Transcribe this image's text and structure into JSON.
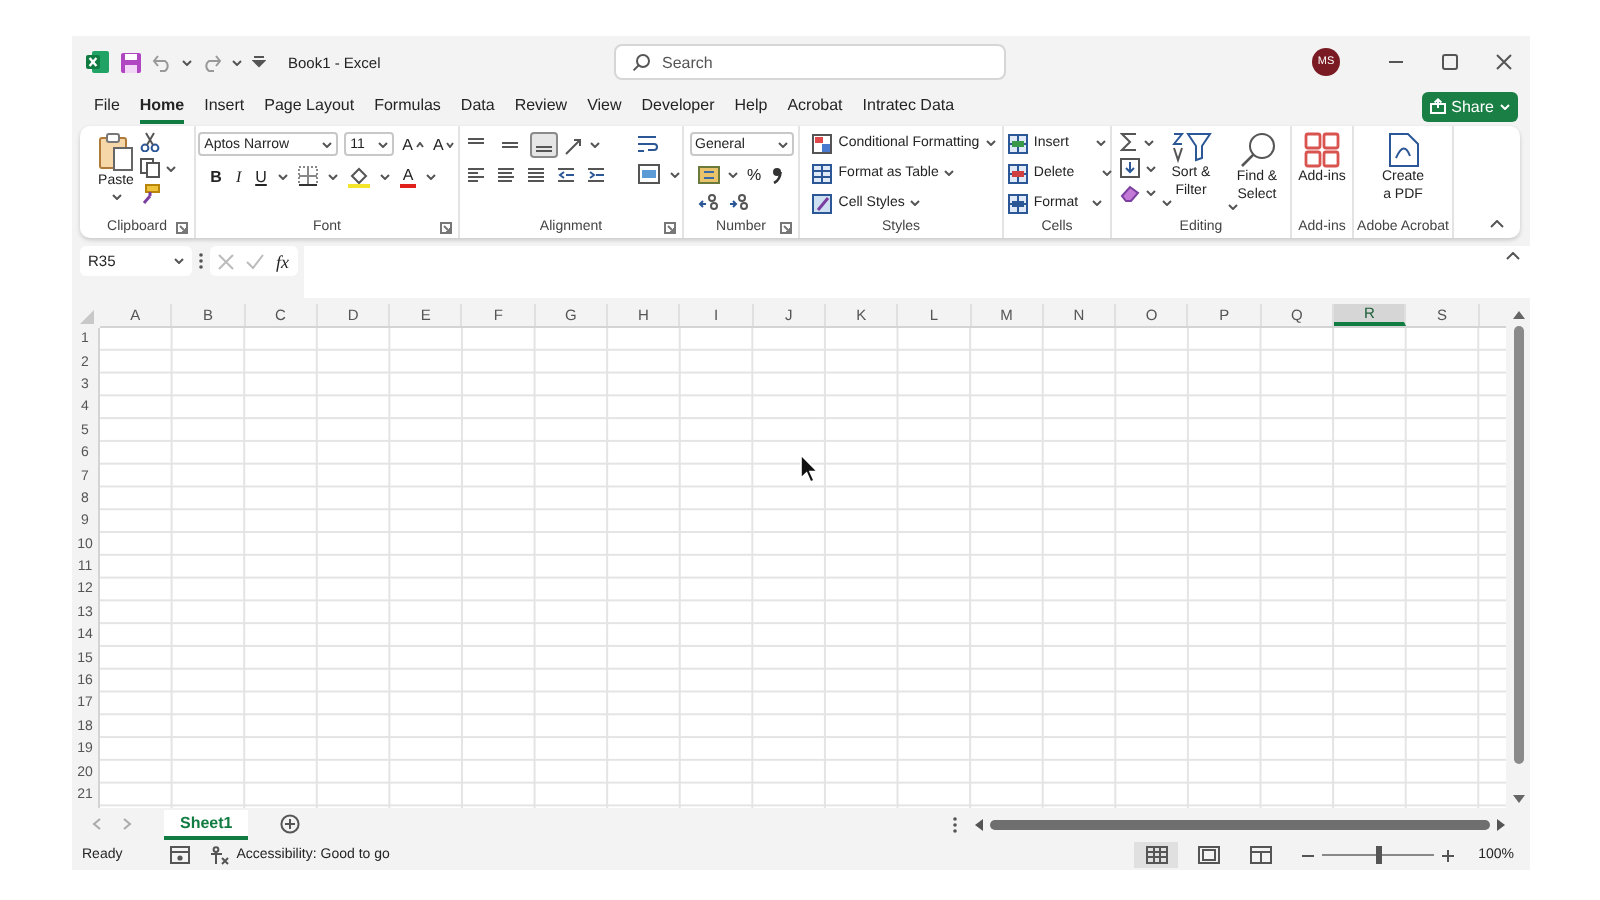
{
  "window": {
    "title": "Book1  -  Excel",
    "search": {
      "placeholder": "Search"
    },
    "account": {
      "initials": "MS"
    }
  },
  "menu_tabs": [
    {
      "label": "File",
      "selected": false
    },
    {
      "label": "Home",
      "selected": true
    },
    {
      "label": "Insert",
      "selected": false
    },
    {
      "label": "Page Layout",
      "selected": false
    },
    {
      "label": "Formulas",
      "selected": false
    },
    {
      "label": "Data",
      "selected": false
    },
    {
      "label": "Review",
      "selected": false
    },
    {
      "label": "View",
      "selected": false
    },
    {
      "label": "Developer",
      "selected": false
    },
    {
      "label": "Help",
      "selected": false
    },
    {
      "label": "Acrobat",
      "selected": false
    },
    {
      "label": "Intratec Data",
      "selected": false
    }
  ],
  "share_button": {
    "label": "Share"
  },
  "ribbon": {
    "groups": [
      {
        "kind": "clipboard",
        "label": "Clipboard",
        "paste": "Paste"
      },
      {
        "kind": "font",
        "label": "Font",
        "font_name": "Aptos Narrow",
        "font_size": "11",
        "grow": "A",
        "shrink": "A",
        "bold": "B",
        "italic": "I",
        "underline": "U",
        "font_color": "A"
      },
      {
        "kind": "alignment",
        "label": "Alignment",
        "vertical_alignment": [
          {
            "selected": false
          },
          {
            "selected": false
          },
          {
            "selected": true
          }
        ]
      },
      {
        "kind": "number",
        "label": "Number",
        "format": "General",
        "percent": "%"
      },
      {
        "kind": "styles",
        "label": "Styles",
        "commands": [
          "Conditional Formatting",
          "Format as Table",
          "Cell Styles"
        ]
      },
      {
        "kind": "cells",
        "label": "Cells",
        "commands": [
          "Insert",
          "Delete",
          "Format"
        ]
      },
      {
        "kind": "editing",
        "label": "Editing",
        "commands": [
          "Sort & Filter",
          "Find & Select"
        ]
      },
      {
        "kind": "addins",
        "label": "Add-ins",
        "button": "Add-ins"
      },
      {
        "kind": "acrobat",
        "label": "Adobe Acrobat",
        "button": "Create a PDF"
      }
    ]
  },
  "formula_bar": {
    "name_box": "R35",
    "function": "fx"
  },
  "sheet": {
    "columns": [
      {
        "label": "A",
        "selected": false
      },
      {
        "label": "B",
        "selected": false
      },
      {
        "label": "C",
        "selected": false
      },
      {
        "label": "D",
        "selected": false
      },
      {
        "label": "E",
        "selected": false
      },
      {
        "label": "F",
        "selected": false
      },
      {
        "label": "G",
        "selected": false
      },
      {
        "label": "H",
        "selected": false
      },
      {
        "label": "I",
        "selected": false
      },
      {
        "label": "J",
        "selected": false
      },
      {
        "label": "K",
        "selected": false
      },
      {
        "label": "L",
        "selected": false
      },
      {
        "label": "M",
        "selected": false
      },
      {
        "label": "N",
        "selected": false
      },
      {
        "label": "O",
        "selected": false
      },
      {
        "label": "P",
        "selected": false
      },
      {
        "label": "Q",
        "selected": false
      },
      {
        "label": "R",
        "selected": true
      },
      {
        "label": "S",
        "selected": false
      }
    ],
    "rows": [
      "1",
      "2",
      "3",
      "4",
      "5",
      "6",
      "7",
      "8",
      "9",
      "10",
      "11",
      "12",
      "13",
      "14",
      "15",
      "16",
      "17",
      "18",
      "19",
      "20",
      "21"
    ]
  },
  "sheet_tabs": [
    {
      "label": "Sheet1",
      "selected": true
    }
  ],
  "status_bar": {
    "mode": "Ready",
    "accessibility": "Accessibility: Good to go",
    "views": [
      {
        "selected": true
      },
      {
        "selected": false
      },
      {
        "selected": false
      }
    ],
    "zoom": {
      "level": 0.5,
      "label": "100%"
    }
  }
}
